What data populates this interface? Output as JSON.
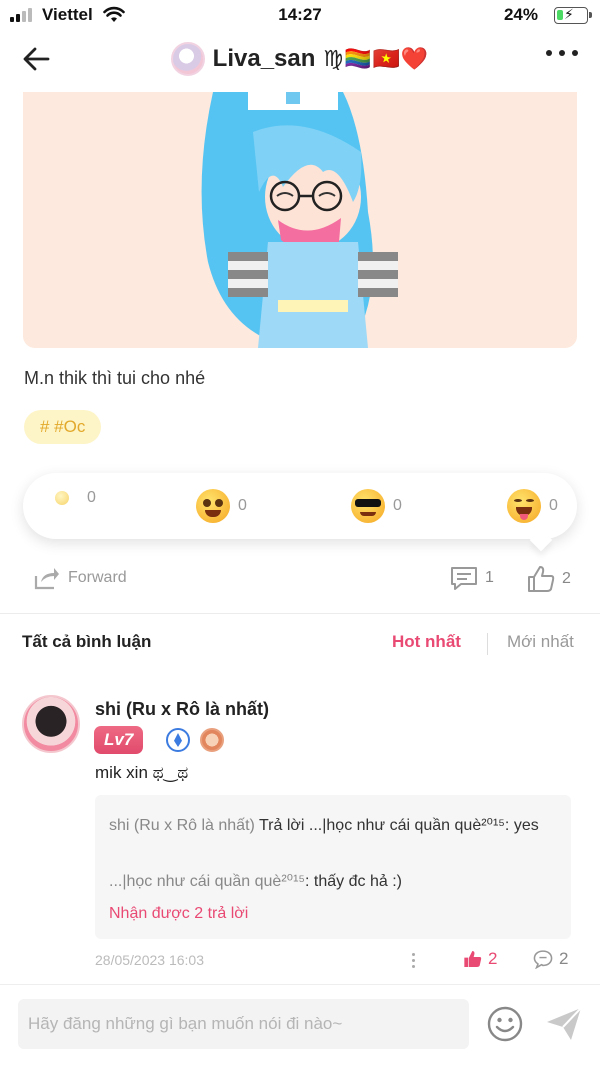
{
  "status_bar": {
    "carrier": "Viettel",
    "time": "14:27",
    "battery": "24%",
    "battery_level": 0.24
  },
  "header": {
    "title": "Liva_san",
    "title_emojis": "♍🏳️‍🌈🇻🇳❤️"
  },
  "post": {
    "caption": "M.n thik thì tui cho nhé",
    "tag": "# #Oc"
  },
  "reactions": [
    {
      "icon": "sparkle-emoji-icon",
      "count": "0"
    },
    {
      "icon": "smiling-eyes-emoji-icon",
      "count": "0"
    },
    {
      "icon": "sunglasses-emoji-icon",
      "count": "0"
    },
    {
      "icon": "laughing-emoji-icon",
      "count": "0"
    }
  ],
  "actions": {
    "forward_label": "Forward",
    "comments": "1",
    "likes": "2"
  },
  "comments_header": {
    "title": "Tất cả bình luận",
    "sort_hot": "Hot nhất",
    "sort_new": "Mới nhất"
  },
  "comment": {
    "name": "shi (Ru x Rô là nhất)",
    "level": "Lv7",
    "text": "mik xin ಥ‿ಥ",
    "reply1_author": "shi (Ru x Rô là nhất)",
    "reply1_text": " Trả lời ...|học như cái quần què²⁰¹⁵: yes",
    "reply2_author": "...|học như cái quần què²⁰¹⁵",
    "reply2_text": ": thấy đc hả :)",
    "more_replies": "Nhận được 2 trả lời",
    "date": "28/05/2023 16:03",
    "likes": "2",
    "replies": "2"
  },
  "composer": {
    "placeholder": "Hãy đăng những gì bạn muốn nói đi nào~"
  },
  "colors": {
    "accent": "#e94a74",
    "tag_text": "#e2a92a",
    "tag_bg": "#fdf4c8",
    "image_bg": "#fde9dd"
  }
}
